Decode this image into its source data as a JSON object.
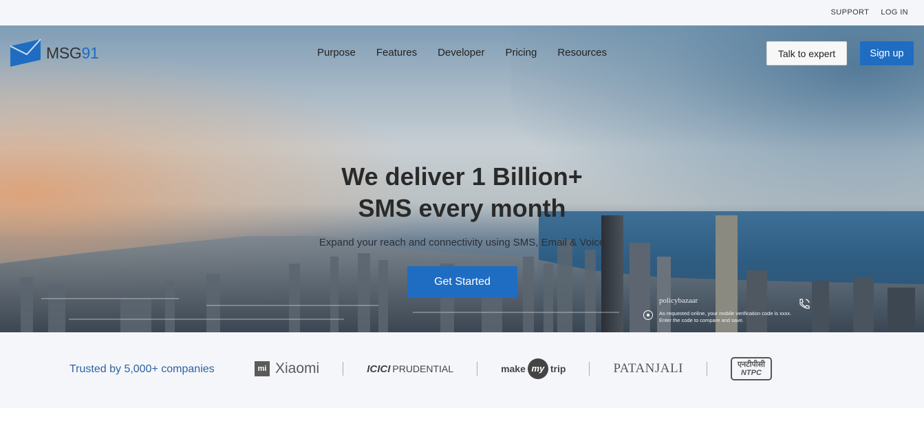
{
  "topbar": {
    "support": "SUPPORT",
    "login": "LOG IN"
  },
  "logo": {
    "text": "MSG",
    "number": "91"
  },
  "nav": {
    "items": [
      "Purpose",
      "Features",
      "Developer",
      "Pricing",
      "Resources"
    ]
  },
  "header_buttons": {
    "expert": "Talk to expert",
    "signup": "Sign up"
  },
  "hero": {
    "headline_1": "We deliver 1 Billion+",
    "headline_2": "SMS every month",
    "subline": "Expand your reach and connectivity using SMS, Email & Voice",
    "cta": "Get Started"
  },
  "notification": {
    "brand": "policybazaar",
    "message_1": "As requested online, your mobile verification code is xxxx.",
    "message_2": "Enter the code to compare and save."
  },
  "trusted": {
    "label": "Trusted by 5,000+ companies",
    "logos": {
      "xiaomi_mark": "mi",
      "xiaomi": "Xiaomi",
      "icici": "ICICI",
      "icici_sub": "PRUDENTIAL",
      "mmt_make": "make",
      "mmt_my": "my",
      "mmt_trip": "trip",
      "patanjali": "PATANJALI",
      "ntpc_hi": "एनटीपीसी",
      "ntpc_en": "NTPC"
    }
  },
  "colors": {
    "brand_blue": "#1f6dc2",
    "label_blue": "#2c62a3",
    "topbar_bg": "#f5f6fa"
  }
}
